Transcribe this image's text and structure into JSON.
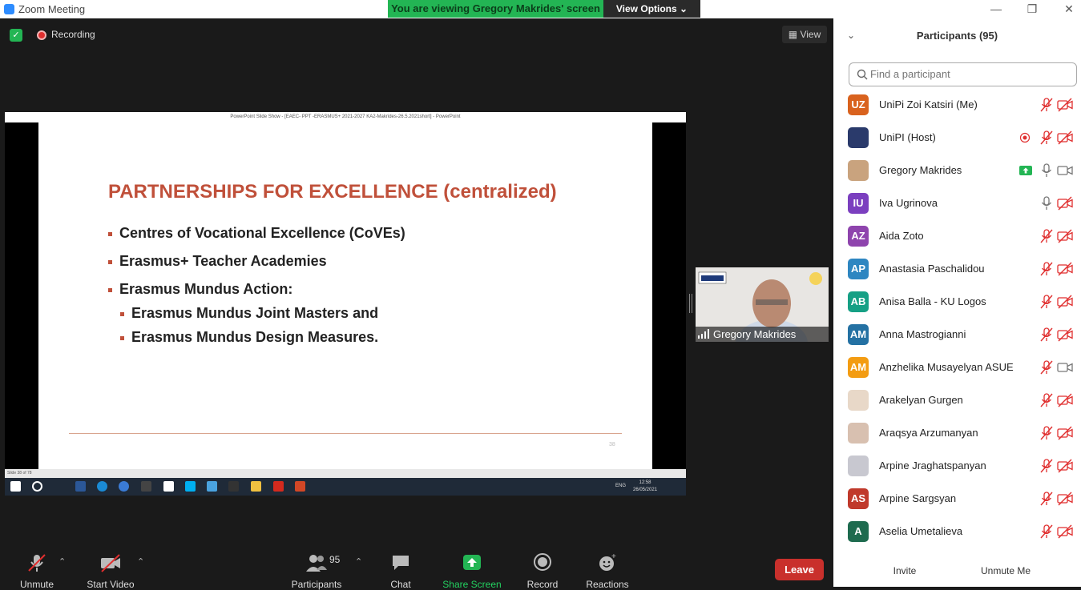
{
  "window": {
    "title": "Zoom Meeting"
  },
  "banner": {
    "text": "You are viewing Gregory Makrides' screen",
    "view_options": "View Options"
  },
  "meeting": {
    "recording_label": "Recording",
    "view_label": "View"
  },
  "powerpoint": {
    "window_title": "PowerPoint Slide Show - [EAEC- PPT -ERASMUS+ 2021-2027 KA2-Makrides-26.5.2021short] - PowerPoint",
    "status": "Slide 38 of 78",
    "slide": {
      "title": "PARTNERSHIPS FOR EXCELLENCE (centralized)",
      "bullets": [
        "Centres of Vocational Excellence (CoVEs)",
        "Erasmus+ Teacher Academies",
        "Erasmus Mundus Action:"
      ],
      "sub_bullets": [
        "Erasmus Mundus Joint Masters and",
        "Erasmus Mundus Design Measures."
      ],
      "page_number": "38"
    },
    "taskbar": {
      "lang": "ENG",
      "time": "12:58",
      "date": "26/05/2021"
    }
  },
  "video": {
    "name": "Gregory Makrides"
  },
  "toolbar": {
    "unmute": "Unmute",
    "start_video": "Start Video",
    "participants": "Participants",
    "participant_count": "95",
    "chat": "Chat",
    "share_screen": "Share Screen",
    "record": "Record",
    "reactions": "Reactions",
    "leave": "Leave"
  },
  "panel": {
    "title": "Participants (95)",
    "search_placeholder": "Find a participant",
    "invite": "Invite",
    "unmute_me": "Unmute Me",
    "participants": [
      {
        "name": "UniPi Zoi Katsiri (Me)",
        "initials": "UZ",
        "color": "#d9621e",
        "mic": "muted",
        "cam": "off"
      },
      {
        "name": "UniPI (Host)",
        "initials": "",
        "color": "#2a3a6b",
        "mic": "muted",
        "cam": "off",
        "recording": true
      },
      {
        "name": "Gregory Makrides",
        "initials": "",
        "color": "#c9a37e",
        "mic": "on",
        "cam": "on",
        "sharing": true
      },
      {
        "name": "Iva Ugrinova",
        "initials": "IU",
        "color": "#7b3fbf",
        "mic": "on",
        "cam": "off"
      },
      {
        "name": "Aida Zoto",
        "initials": "AZ",
        "color": "#8e44ad",
        "mic": "muted",
        "cam": "off"
      },
      {
        "name": "Anastasia Paschalidou",
        "initials": "AP",
        "color": "#2e86c1",
        "mic": "muted",
        "cam": "off"
      },
      {
        "name": "Anisa Balla - KU Logos",
        "initials": "AB",
        "color": "#16a085",
        "mic": "muted",
        "cam": "off"
      },
      {
        "name": "Anna Mastrogianni",
        "initials": "AM",
        "color": "#2471a3",
        "mic": "muted",
        "cam": "off"
      },
      {
        "name": "Anzhelika Musayelyan  ASUE",
        "initials": "AM",
        "color": "#f39c12",
        "mic": "muted",
        "cam": "on"
      },
      {
        "name": "Arakelyan Gurgen",
        "initials": "",
        "color": "#e8d8c8",
        "mic": "muted",
        "cam": "off"
      },
      {
        "name": "Araqsya Arzumanyan",
        "initials": "",
        "color": "#d8c0b0",
        "mic": "muted",
        "cam": "off"
      },
      {
        "name": "Arpine Jraghatspanyan",
        "initials": "",
        "color": "#c8c8d0",
        "mic": "muted",
        "cam": "off"
      },
      {
        "name": "Arpine Sargsyan",
        "initials": "AS",
        "color": "#c0392b",
        "mic": "muted",
        "cam": "off"
      },
      {
        "name": "Aselia Umetalieva",
        "initials": "A",
        "color": "#1e6b4f",
        "mic": "muted",
        "cam": "off"
      }
    ]
  }
}
